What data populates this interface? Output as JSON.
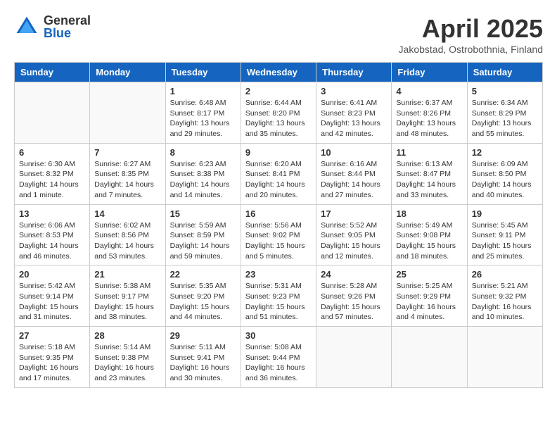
{
  "header": {
    "logo_general": "General",
    "logo_blue": "Blue",
    "title": "April 2025",
    "location": "Jakobstad, Ostrobothnia, Finland"
  },
  "days_of_week": [
    "Sunday",
    "Monday",
    "Tuesday",
    "Wednesday",
    "Thursday",
    "Friday",
    "Saturday"
  ],
  "weeks": [
    [
      {
        "day": "",
        "info": ""
      },
      {
        "day": "",
        "info": ""
      },
      {
        "day": "1",
        "info": "Sunrise: 6:48 AM\nSunset: 8:17 PM\nDaylight: 13 hours and 29 minutes."
      },
      {
        "day": "2",
        "info": "Sunrise: 6:44 AM\nSunset: 8:20 PM\nDaylight: 13 hours and 35 minutes."
      },
      {
        "day": "3",
        "info": "Sunrise: 6:41 AM\nSunset: 8:23 PM\nDaylight: 13 hours and 42 minutes."
      },
      {
        "day": "4",
        "info": "Sunrise: 6:37 AM\nSunset: 8:26 PM\nDaylight: 13 hours and 48 minutes."
      },
      {
        "day": "5",
        "info": "Sunrise: 6:34 AM\nSunset: 8:29 PM\nDaylight: 13 hours and 55 minutes."
      }
    ],
    [
      {
        "day": "6",
        "info": "Sunrise: 6:30 AM\nSunset: 8:32 PM\nDaylight: 14 hours and 1 minute."
      },
      {
        "day": "7",
        "info": "Sunrise: 6:27 AM\nSunset: 8:35 PM\nDaylight: 14 hours and 7 minutes."
      },
      {
        "day": "8",
        "info": "Sunrise: 6:23 AM\nSunset: 8:38 PM\nDaylight: 14 hours and 14 minutes."
      },
      {
        "day": "9",
        "info": "Sunrise: 6:20 AM\nSunset: 8:41 PM\nDaylight: 14 hours and 20 minutes."
      },
      {
        "day": "10",
        "info": "Sunrise: 6:16 AM\nSunset: 8:44 PM\nDaylight: 14 hours and 27 minutes."
      },
      {
        "day": "11",
        "info": "Sunrise: 6:13 AM\nSunset: 8:47 PM\nDaylight: 14 hours and 33 minutes."
      },
      {
        "day": "12",
        "info": "Sunrise: 6:09 AM\nSunset: 8:50 PM\nDaylight: 14 hours and 40 minutes."
      }
    ],
    [
      {
        "day": "13",
        "info": "Sunrise: 6:06 AM\nSunset: 8:53 PM\nDaylight: 14 hours and 46 minutes."
      },
      {
        "day": "14",
        "info": "Sunrise: 6:02 AM\nSunset: 8:56 PM\nDaylight: 14 hours and 53 minutes."
      },
      {
        "day": "15",
        "info": "Sunrise: 5:59 AM\nSunset: 8:59 PM\nDaylight: 14 hours and 59 minutes."
      },
      {
        "day": "16",
        "info": "Sunrise: 5:56 AM\nSunset: 9:02 PM\nDaylight: 15 hours and 5 minutes."
      },
      {
        "day": "17",
        "info": "Sunrise: 5:52 AM\nSunset: 9:05 PM\nDaylight: 15 hours and 12 minutes."
      },
      {
        "day": "18",
        "info": "Sunrise: 5:49 AM\nSunset: 9:08 PM\nDaylight: 15 hours and 18 minutes."
      },
      {
        "day": "19",
        "info": "Sunrise: 5:45 AM\nSunset: 9:11 PM\nDaylight: 15 hours and 25 minutes."
      }
    ],
    [
      {
        "day": "20",
        "info": "Sunrise: 5:42 AM\nSunset: 9:14 PM\nDaylight: 15 hours and 31 minutes."
      },
      {
        "day": "21",
        "info": "Sunrise: 5:38 AM\nSunset: 9:17 PM\nDaylight: 15 hours and 38 minutes."
      },
      {
        "day": "22",
        "info": "Sunrise: 5:35 AM\nSunset: 9:20 PM\nDaylight: 15 hours and 44 minutes."
      },
      {
        "day": "23",
        "info": "Sunrise: 5:31 AM\nSunset: 9:23 PM\nDaylight: 15 hours and 51 minutes."
      },
      {
        "day": "24",
        "info": "Sunrise: 5:28 AM\nSunset: 9:26 PM\nDaylight: 15 hours and 57 minutes."
      },
      {
        "day": "25",
        "info": "Sunrise: 5:25 AM\nSunset: 9:29 PM\nDaylight: 16 hours and 4 minutes."
      },
      {
        "day": "26",
        "info": "Sunrise: 5:21 AM\nSunset: 9:32 PM\nDaylight: 16 hours and 10 minutes."
      }
    ],
    [
      {
        "day": "27",
        "info": "Sunrise: 5:18 AM\nSunset: 9:35 PM\nDaylight: 16 hours and 17 minutes."
      },
      {
        "day": "28",
        "info": "Sunrise: 5:14 AM\nSunset: 9:38 PM\nDaylight: 16 hours and 23 minutes."
      },
      {
        "day": "29",
        "info": "Sunrise: 5:11 AM\nSunset: 9:41 PM\nDaylight: 16 hours and 30 minutes."
      },
      {
        "day": "30",
        "info": "Sunrise: 5:08 AM\nSunset: 9:44 PM\nDaylight: 16 hours and 36 minutes."
      },
      {
        "day": "",
        "info": ""
      },
      {
        "day": "",
        "info": ""
      },
      {
        "day": "",
        "info": ""
      }
    ]
  ]
}
